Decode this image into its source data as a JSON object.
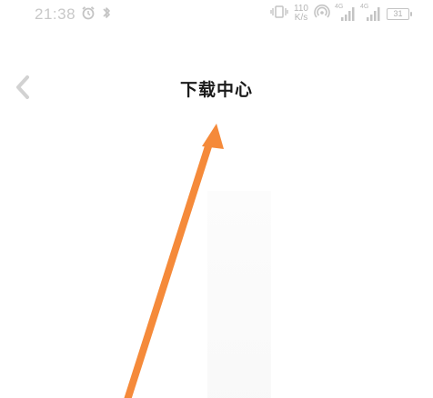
{
  "status_bar": {
    "time": "21:38",
    "network_speed_value": "110",
    "network_speed_unit": "K/s",
    "signal1_label": "4G",
    "signal2_label": "4G",
    "battery_level": "31",
    "icon_alarm": "alarm-icon",
    "icon_bluetooth": "bluetooth-icon",
    "icon_vibrate": "vibrate-icon",
    "icon_hotspot": "hotspot-icon"
  },
  "nav": {
    "title": "下载中心",
    "back_icon": "chevron-left-icon"
  },
  "colors": {
    "title": "#1a1a1a",
    "status_text": "#c8c8c8",
    "arrow": "#f58a3a"
  }
}
